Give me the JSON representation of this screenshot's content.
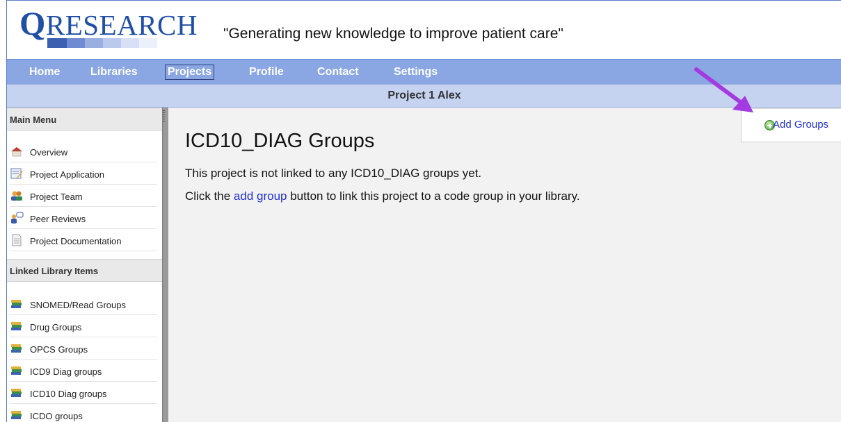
{
  "header": {
    "logo_q": "Q",
    "logo_rest": "RESEARCH",
    "tagline": "\"Generating new knowledge to improve patient care\""
  },
  "nav": {
    "items": [
      {
        "label": "Home"
      },
      {
        "label": "Libraries"
      },
      {
        "label": "Projects",
        "active": true
      },
      {
        "label": "Profile"
      },
      {
        "label": "Contact"
      },
      {
        "label": "Settings"
      }
    ]
  },
  "project_bar": {
    "title": "Project 1 Alex"
  },
  "sidebar": {
    "main_menu_title": "Main Menu",
    "main_menu": [
      {
        "label": "Overview",
        "icon": "house-icon"
      },
      {
        "label": "Project Application",
        "icon": "edit-form-icon"
      },
      {
        "label": "Project Team",
        "icon": "team-icon"
      },
      {
        "label": "Peer Reviews",
        "icon": "reviewer-icon"
      },
      {
        "label": "Project Documentation",
        "icon": "document-icon"
      }
    ],
    "linked_title": "Linked Library Items",
    "linked_items": [
      {
        "label": "SNOMED/Read Groups",
        "icon": "books-icon"
      },
      {
        "label": "Drug Groups",
        "icon": "books-icon"
      },
      {
        "label": "OPCS Groups",
        "icon": "books-icon"
      },
      {
        "label": "ICD9 Diag groups",
        "icon": "books-icon"
      },
      {
        "label": "ICD10 Diag groups",
        "icon": "books-icon"
      },
      {
        "label": "ICDO groups",
        "icon": "books-icon"
      }
    ]
  },
  "main": {
    "title": "ICD10_DIAG Groups",
    "line1": "This project is not linked to any ICD10_DIAG groups yet.",
    "line2_pre": "Click the ",
    "line2_link": "add group",
    "line2_post": " button to link this project to a code group in your library."
  },
  "actions": {
    "add_groups": "Add Groups"
  },
  "colors": {
    "nav_bg": "#8aa6e3",
    "project_bar_bg": "#c5d2f0",
    "link": "#1f2fd1",
    "arrow": "#a43be0"
  }
}
